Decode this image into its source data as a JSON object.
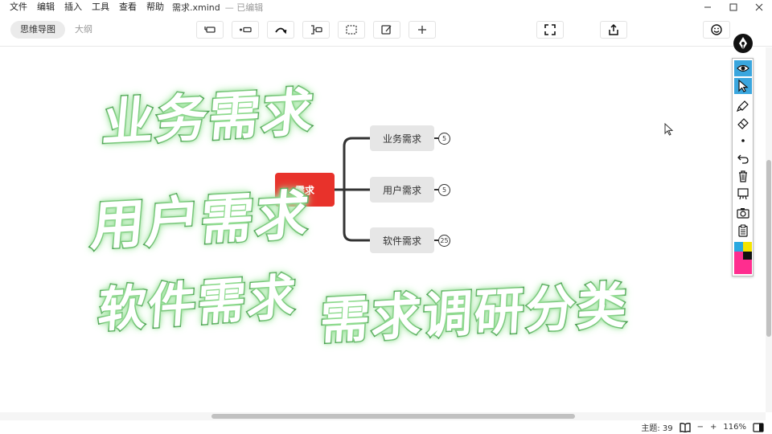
{
  "menu": [
    "文件",
    "编辑",
    "插入",
    "工具",
    "查看",
    "帮助"
  ],
  "document": {
    "title": "需求.xmind",
    "status": "— 已编辑"
  },
  "view_tabs": [
    {
      "label": "思维导图",
      "active": true
    },
    {
      "label": "大纲",
      "active": false
    }
  ],
  "mindmap": {
    "central_topic": "需求",
    "topics": [
      {
        "label": "业务需求",
        "count": "5"
      },
      {
        "label": "用户需求",
        "count": "5"
      },
      {
        "label": "软件需求",
        "count": "25"
      }
    ]
  },
  "overlay_titles": [
    "业务需求",
    "用户需求",
    "软件需求",
    "需求调研分类"
  ],
  "status": {
    "topic_count_label": "主题: 39",
    "zoom_minus": "−",
    "zoom_plus": "+",
    "zoom_level": "116%"
  },
  "palette_colors": [
    "#29a8e0",
    "#f5e400",
    "#ff2d8f",
    "#111111"
  ],
  "colors": {
    "central_topic": "#e8322b",
    "subtopic_bg": "#e6e6e6",
    "overlay_stroke": "#1d7a27",
    "accent": "#3aa6de"
  }
}
